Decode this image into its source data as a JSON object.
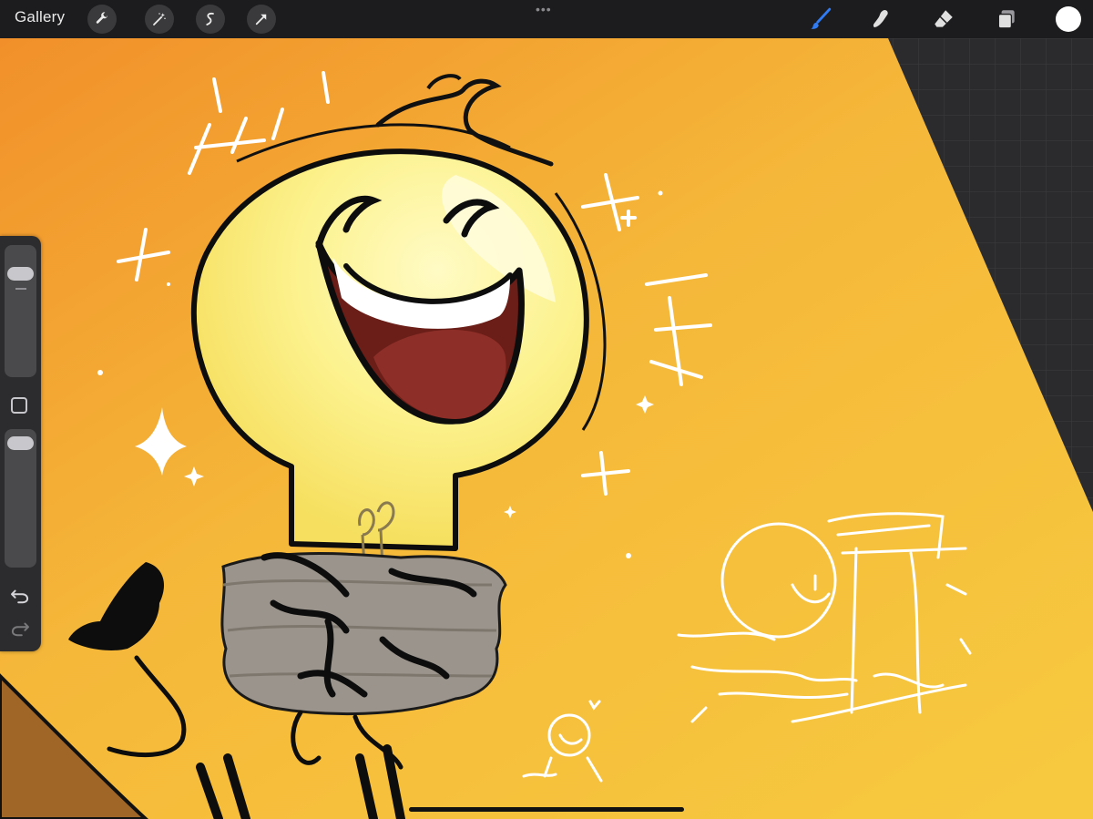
{
  "toolbar": {
    "gallery_label": "Gallery",
    "left_tools": [
      "wrench-icon",
      "magic-wand-icon",
      "selection-icon",
      "transform-arrow-icon"
    ],
    "right_tools": [
      "brush-icon",
      "smudge-icon",
      "eraser-icon",
      "layers-icon"
    ],
    "more_glyph": "•••",
    "active_tool": "brush",
    "active_tool_color": "#2f7cf6",
    "current_color": "#ffffff"
  },
  "sidebar": {
    "brush_size_level": 0.95,
    "opacity_level": 0.97,
    "undo_icon": "undo-icon",
    "redo_icon": "redo-icon",
    "modify_icon": "square-modify-icon"
  },
  "canvas": {
    "background_gradient": [
      "#f29a2e",
      "#f6c43c"
    ],
    "subject": "light-bulb-character",
    "colors": {
      "bulb": "#fbf08c",
      "mouth": "#6a1e17",
      "tongue": "#8e2e28",
      "base": "#9a948c",
      "outline": "#0d0d0d",
      "sparkles": "#ffffff",
      "floor": "#a06628"
    }
  }
}
